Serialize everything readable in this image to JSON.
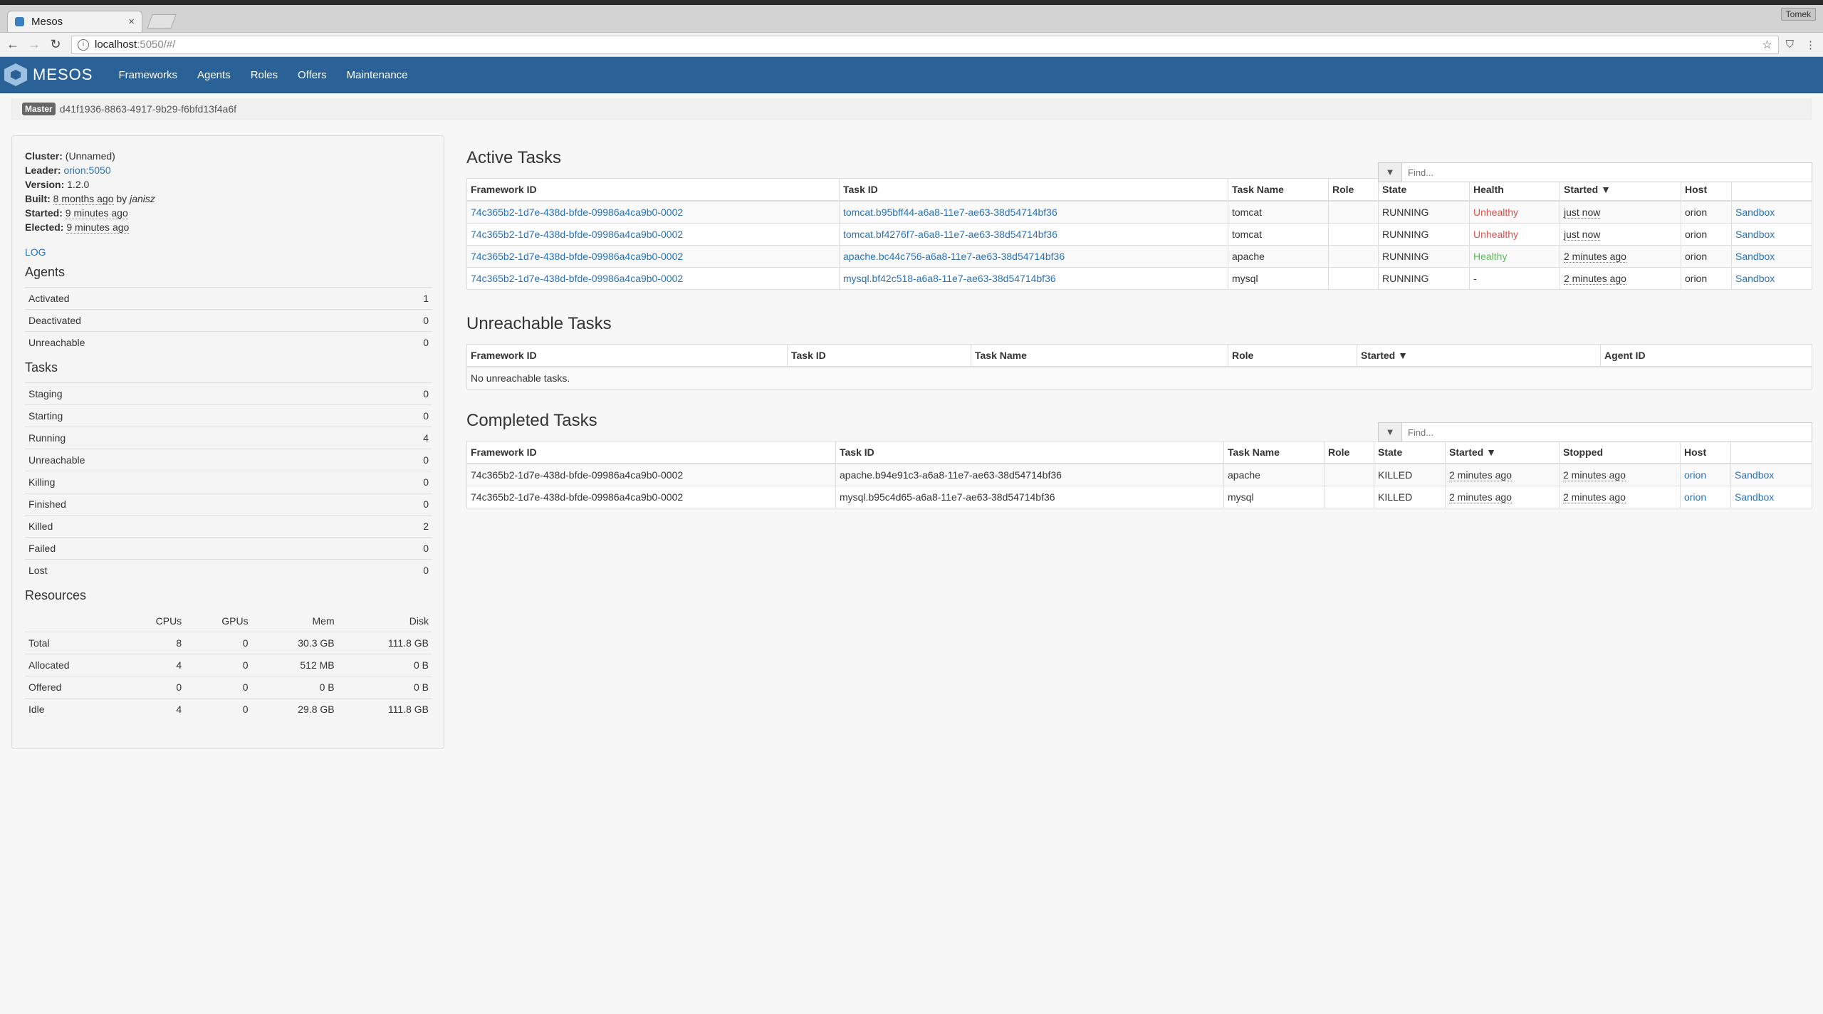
{
  "browser": {
    "tab_title": "Mesos",
    "tab_close": "×",
    "url_host": "localhost",
    "url_path": ":5050/#/",
    "profile": "Tomek"
  },
  "nav": {
    "brand": "MESOS",
    "links": [
      "Frameworks",
      "Agents",
      "Roles",
      "Offers",
      "Maintenance"
    ]
  },
  "master": {
    "badge": "Master",
    "id": "d41f1936-8863-4917-9b29-f6bfd13f4a6f"
  },
  "summary": {
    "cluster_label": "Cluster:",
    "cluster": "(Unnamed)",
    "leader_label": "Leader:",
    "leader": "orion:5050",
    "version_label": "Version:",
    "version": "1.2.0",
    "built_label": "Built:",
    "built": "8 months ago",
    "built_by_prefix": "by",
    "built_by": "janisz",
    "started_label": "Started:",
    "started": "9 minutes ago",
    "elected_label": "Elected:",
    "elected": "9 minutes ago",
    "log": "LOG"
  },
  "agents": {
    "title": "Agents",
    "rows": [
      {
        "label": "Activated",
        "value": "1"
      },
      {
        "label": "Deactivated",
        "value": "0"
      },
      {
        "label": "Unreachable",
        "value": "0"
      }
    ]
  },
  "tasks_summary": {
    "title": "Tasks",
    "rows": [
      {
        "label": "Staging",
        "value": "0"
      },
      {
        "label": "Starting",
        "value": "0"
      },
      {
        "label": "Running",
        "value": "4"
      },
      {
        "label": "Unreachable",
        "value": "0"
      },
      {
        "label": "Killing",
        "value": "0"
      },
      {
        "label": "Finished",
        "value": "0"
      },
      {
        "label": "Killed",
        "value": "2"
      },
      {
        "label": "Failed",
        "value": "0"
      },
      {
        "label": "Lost",
        "value": "0"
      }
    ]
  },
  "resources": {
    "title": "Resources",
    "headers": [
      "",
      "CPUs",
      "GPUs",
      "Mem",
      "Disk"
    ],
    "rows": [
      [
        "Total",
        "8",
        "0",
        "30.3 GB",
        "111.8 GB"
      ],
      [
        "Allocated",
        "4",
        "0",
        "512 MB",
        "0 B"
      ],
      [
        "Offered",
        "0",
        "0",
        "0 B",
        "0 B"
      ],
      [
        "Idle",
        "4",
        "0",
        "29.8 GB",
        "111.8 GB"
      ]
    ]
  },
  "active": {
    "title": "Active Tasks",
    "filter_placeholder": "Find...",
    "headers": [
      "Framework ID",
      "Task ID",
      "Task Name",
      "Role",
      "State",
      "Health",
      "Started ▼",
      "Host",
      ""
    ],
    "rows": [
      {
        "framework": "74c365b2-1d7e-438d-bfde-09986a4ca9b0-0002",
        "task": "tomcat.b95bff44-a6a8-11e7-ae63-38d54714bf36",
        "name": "tomcat",
        "role": "",
        "state": "RUNNING",
        "health": "Unhealthy",
        "health_class": "unhealthy",
        "started": "just now",
        "host": "orion",
        "sandbox": "Sandbox"
      },
      {
        "framework": "74c365b2-1d7e-438d-bfde-09986a4ca9b0-0002",
        "task": "tomcat.bf4276f7-a6a8-11e7-ae63-38d54714bf36",
        "name": "tomcat",
        "role": "",
        "state": "RUNNING",
        "health": "Unhealthy",
        "health_class": "unhealthy",
        "started": "just now",
        "host": "orion",
        "sandbox": "Sandbox"
      },
      {
        "framework": "74c365b2-1d7e-438d-bfde-09986a4ca9b0-0002",
        "task": "apache.bc44c756-a6a8-11e7-ae63-38d54714bf36",
        "name": "apache",
        "role": "",
        "state": "RUNNING",
        "health": "Healthy",
        "health_class": "healthy",
        "started": "2 minutes ago",
        "host": "orion",
        "sandbox": "Sandbox"
      },
      {
        "framework": "74c365b2-1d7e-438d-bfde-09986a4ca9b0-0002",
        "task": "mysql.bf42c518-a6a8-11e7-ae63-38d54714bf36",
        "name": "mysql",
        "role": "",
        "state": "RUNNING",
        "health": "-",
        "health_class": "",
        "started": "2 minutes ago",
        "host": "orion",
        "sandbox": "Sandbox"
      }
    ]
  },
  "unreachable": {
    "title": "Unreachable Tasks",
    "headers": [
      "Framework ID",
      "Task ID",
      "Task Name",
      "Role",
      "Started ▼",
      "Agent ID"
    ],
    "empty": "No unreachable tasks."
  },
  "completed": {
    "title": "Completed Tasks",
    "filter_placeholder": "Find...",
    "headers": [
      "Framework ID",
      "Task ID",
      "Task Name",
      "Role",
      "State",
      "Started ▼",
      "Stopped",
      "Host",
      ""
    ],
    "rows": [
      {
        "framework": "74c365b2-1d7e-438d-bfde-09986a4ca9b0-0002",
        "task": "apache.b94e91c3-a6a8-11e7-ae63-38d54714bf36",
        "name": "apache",
        "role": "",
        "state": "KILLED",
        "started": "2 minutes ago",
        "stopped": "2 minutes ago",
        "host": "orion",
        "sandbox": "Sandbox"
      },
      {
        "framework": "74c365b2-1d7e-438d-bfde-09986a4ca9b0-0002",
        "task": "mysql.b95c4d65-a6a8-11e7-ae63-38d54714bf36",
        "name": "mysql",
        "role": "",
        "state": "KILLED",
        "started": "2 minutes ago",
        "stopped": "2 minutes ago",
        "host": "orion",
        "sandbox": "Sandbox"
      }
    ]
  }
}
